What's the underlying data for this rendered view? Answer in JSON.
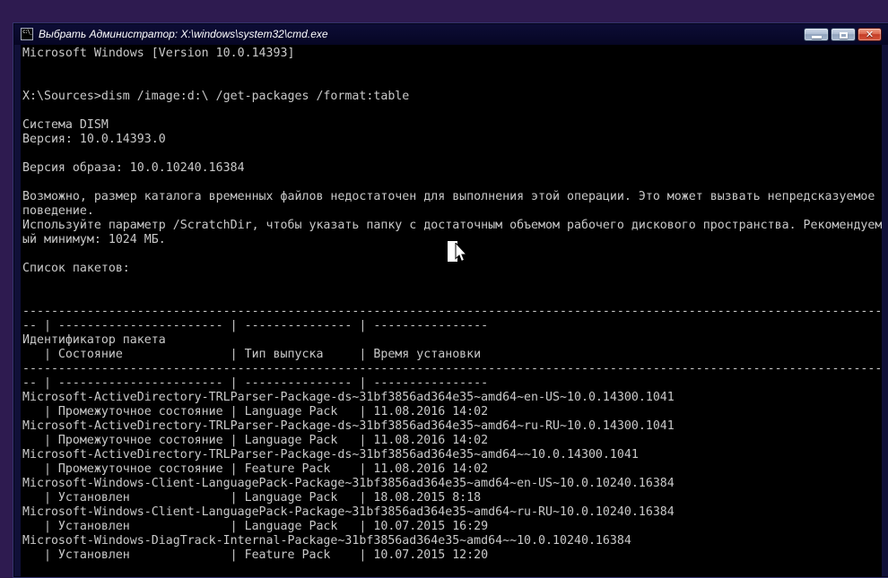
{
  "window": {
    "title": "Выбрать Администратор: X:\\windows\\system32\\cmd.exe",
    "icon": "cmd-icon",
    "controls": [
      {
        "name": "minimize"
      },
      {
        "name": "maximize"
      },
      {
        "name": "close"
      }
    ]
  },
  "console": {
    "lines": [
      "Microsoft Windows [Version 10.0.14393]",
      "",
      "",
      "X:\\Sources>dism /image:d:\\ /get-packages /format:table",
      "",
      "Система DISM",
      "Версия: 10.0.14393.0",
      "",
      "Версия образа: 10.0.10240.16384",
      "",
      "Возможно, размер каталога временных файлов недостаточен для выполнения этой операции. Это может вызвать непредсказуемое",
      "поведение.",
      "Используйте параметр /ScratchDir, чтобы указать папку с достаточным объемом рабочего дискового пространства. Рекомендуем",
      "ый минимум: 1024 МБ.",
      "",
      "Список пакетов:",
      "",
      "",
      "------------------------------------------------------------------------------------------------------------------------",
      "-- | ----------------------- | --------------- | ----------------",
      "Идентификатор пакета",
      "   | Состояние               | Тип выпуска     | Время установки",
      "------------------------------------------------------------------------------------------------------------------------",
      "-- | ----------------------- | --------------- | ----------------",
      "Microsoft-ActiveDirectory-TRLParser-Package-ds~31bf3856ad364e35~amd64~en-US~10.0.14300.1041",
      "   | Промежуточное состояние | Language Pack   | 11.08.2016 14:02",
      "Microsoft-ActiveDirectory-TRLParser-Package-ds~31bf3856ad364e35~amd64~ru-RU~10.0.14300.1041",
      "   | Промежуточное состояние | Language Pack   | 11.08.2016 14:02",
      "Microsoft-ActiveDirectory-TRLParser-Package-ds~31bf3856ad364e35~amd64~~10.0.14300.1041",
      "   | Промежуточное состояние | Feature Pack    | 11.08.2016 14:02",
      "Microsoft-Windows-Client-LanguagePack-Package~31bf3856ad364e35~amd64~en-US~10.0.10240.16384",
      "   | Установлен              | Language Pack   | 18.08.2015 8:18",
      "Microsoft-Windows-Client-LanguagePack-Package~31bf3856ad364e35~amd64~ru-RU~10.0.10240.16384",
      "   | Установлен              | Language Pack   | 10.07.2015 16:29",
      "Microsoft-Windows-DiagTrack-Internal-Package~31bf3856ad364e35~amd64~~10.0.10240.16384",
      "   | Установлен              | Feature Pack    | 10.07.2015 12:20"
    ],
    "table": {
      "columns": [
        "Идентификатор пакета",
        "Состояние",
        "Тип выпуска",
        "Время установки"
      ],
      "rows": [
        {
          "package_id": "Microsoft-ActiveDirectory-TRLParser-Package-ds~31bf3856ad364e35~amd64~en-US~10.0.14300.1041",
          "state": "Промежуточное состояние",
          "release_type": "Language Pack",
          "install_time": "11.08.2016 14:02"
        },
        {
          "package_id": "Microsoft-ActiveDirectory-TRLParser-Package-ds~31bf3856ad364e35~amd64~ru-RU~10.0.14300.1041",
          "state": "Промежуточное состояние",
          "release_type": "Language Pack",
          "install_time": "11.08.2016 14:02"
        },
        {
          "package_id": "Microsoft-ActiveDirectory-TRLParser-Package-ds~31bf3856ad364e35~amd64~~10.0.14300.1041",
          "state": "Промежуточное состояние",
          "release_type": "Feature Pack",
          "install_time": "11.08.2016 14:02"
        },
        {
          "package_id": "Microsoft-Windows-Client-LanguagePack-Package~31bf3856ad364e35~amd64~en-US~10.0.10240.16384",
          "state": "Установлен",
          "release_type": "Language Pack",
          "install_time": "18.08.2015 8:18"
        },
        {
          "package_id": "Microsoft-Windows-Client-LanguagePack-Package~31bf3856ad364e35~amd64~ru-RU~10.0.10240.16384",
          "state": "Установлен",
          "release_type": "Language Pack",
          "install_time": "10.07.2015 16:29"
        },
        {
          "package_id": "Microsoft-Windows-DiagTrack-Internal-Package~31bf3856ad364e35~amd64~~10.0.10240.16384",
          "state": "Установлен",
          "release_type": "Feature Pack",
          "install_time": "10.07.2015 12:20"
        }
      ]
    },
    "icon_label": "c:\\_"
  },
  "colors": {
    "desktop_background": "#2e1b50",
    "titlebar_background": "#0a0a30",
    "console_background": "#000000",
    "console_text": "#c9c9c9",
    "close_button": "#c33b26",
    "window_border": "#101038"
  }
}
